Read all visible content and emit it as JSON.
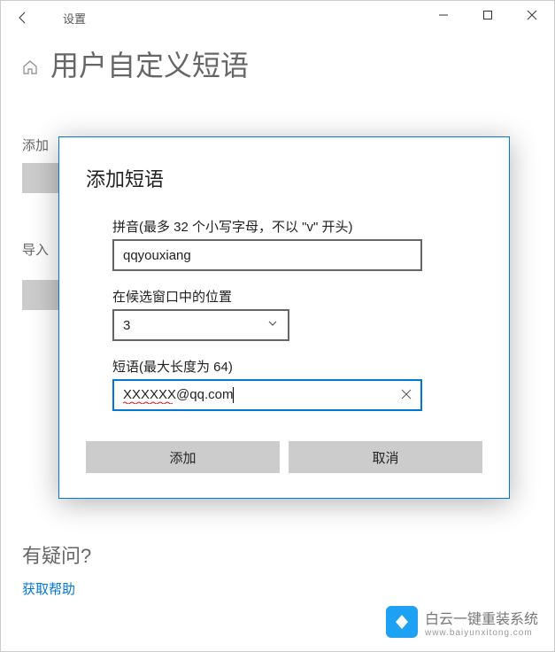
{
  "titlebar": {
    "title": "设置"
  },
  "page": {
    "title": "用户自定义短语",
    "addLabel": "添加",
    "importLabel": "导入"
  },
  "dialog": {
    "title": "添加短语",
    "pinyinLabel": "拼音(最多 32 个小写字母，不以 \"v\" 开头)",
    "pinyinValue": "qqyouxiang",
    "positionLabel": "在候选窗口中的位置",
    "positionValue": "3",
    "phraseLabel": "短语(最大长度为 64)",
    "phraseValue": "XXXXXX@qq.com",
    "addButton": "添加",
    "cancelButton": "取消"
  },
  "help": {
    "title": "有疑问?",
    "link": "获取帮助"
  },
  "watermark": {
    "main": "白云一键重装系统",
    "sub": "www.baiyunxitong.com"
  }
}
